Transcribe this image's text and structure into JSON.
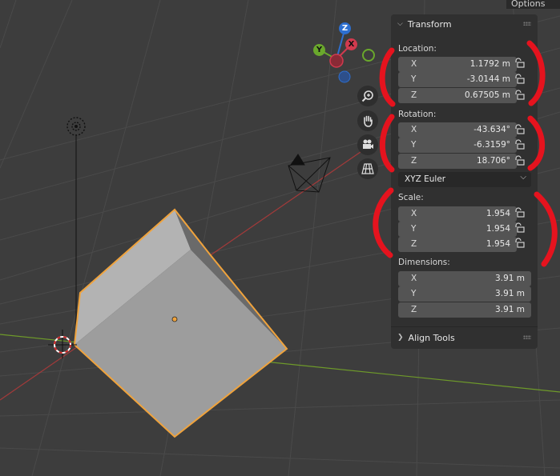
{
  "header": {
    "options_label": "Options"
  },
  "gizmo": {
    "z_label": "Z",
    "y_label": "Y",
    "x_label": "X",
    "colors": {
      "x": "#d13a4e",
      "y": "#6aa82c",
      "z": "#2d6fd0"
    }
  },
  "nav_icons": [
    "zoom-icon",
    "hand-pan-icon",
    "camera-icon",
    "grid-perspective-icon"
  ],
  "transform_panel": {
    "title": "Transform",
    "location": {
      "label": "Location:",
      "rows": [
        {
          "axis": "X",
          "value": "1.1792 m"
        },
        {
          "axis": "Y",
          "value": "-3.0144 m"
        },
        {
          "axis": "Z",
          "value": "0.67505 m"
        }
      ]
    },
    "rotation": {
      "label": "Rotation:",
      "rows": [
        {
          "axis": "X",
          "value": "-43.634°"
        },
        {
          "axis": "Y",
          "value": "-6.3159°"
        },
        {
          "axis": "Z",
          "value": "18.706°"
        }
      ],
      "mode": "XYZ Euler"
    },
    "scale": {
      "label": "Scale:",
      "rows": [
        {
          "axis": "X",
          "value": "1.954"
        },
        {
          "axis": "Y",
          "value": "1.954"
        },
        {
          "axis": "Z",
          "value": "1.954"
        }
      ]
    },
    "dimensions": {
      "label": "Dimensions:",
      "rows": [
        {
          "axis": "X",
          "value": "3.91 m"
        },
        {
          "axis": "Y",
          "value": "3.91 m"
        },
        {
          "axis": "Z",
          "value": "3.91 m"
        }
      ]
    }
  },
  "align_panel": {
    "title": "Align Tools"
  },
  "colors": {
    "selection_outline": "#f0a33c",
    "annotation": "#e5131e",
    "x_axis_line": "#a33a3a",
    "y_axis_line": "#6e9a2a"
  }
}
